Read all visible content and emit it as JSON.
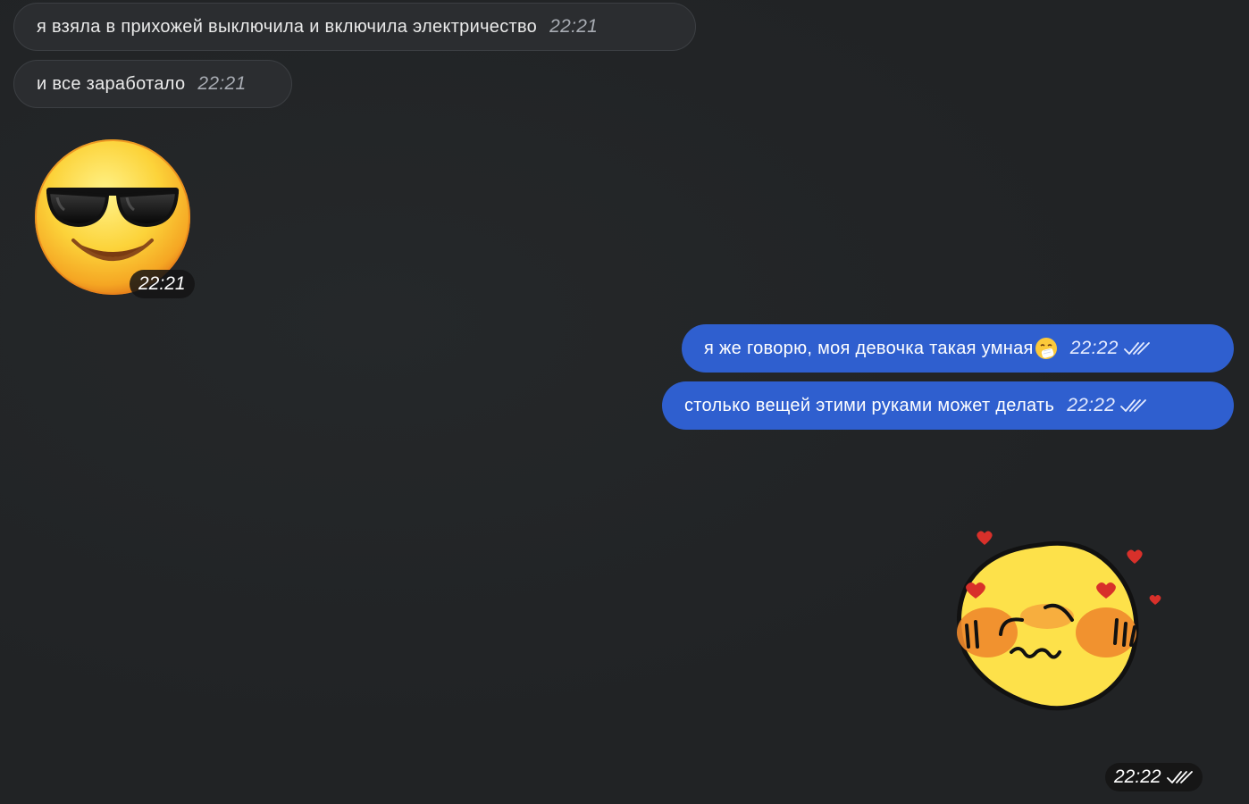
{
  "messages": {
    "in1": {
      "text": "я взяла в прихожей выключила и включила электричество",
      "time": "22:21"
    },
    "in2": {
      "text": "и все заработало",
      "time": "22:21"
    },
    "sticker_in": {
      "icon": "sunglasses-emoji",
      "time": "22:21"
    },
    "out1": {
      "text": "я же говорю, моя девочка такая умная",
      "emoji": "sneezing-face-emoji",
      "time": "22:22"
    },
    "out2": {
      "text": "столько вещей этими руками может делать",
      "time": "22:22"
    },
    "sticker_out": {
      "icon": "blushing-hearts-sticker",
      "time": "22:22"
    }
  },
  "colors": {
    "background": "#212325",
    "incoming_bubble": "#2b2d30",
    "outgoing_bubble": "#2f5fcf"
  }
}
